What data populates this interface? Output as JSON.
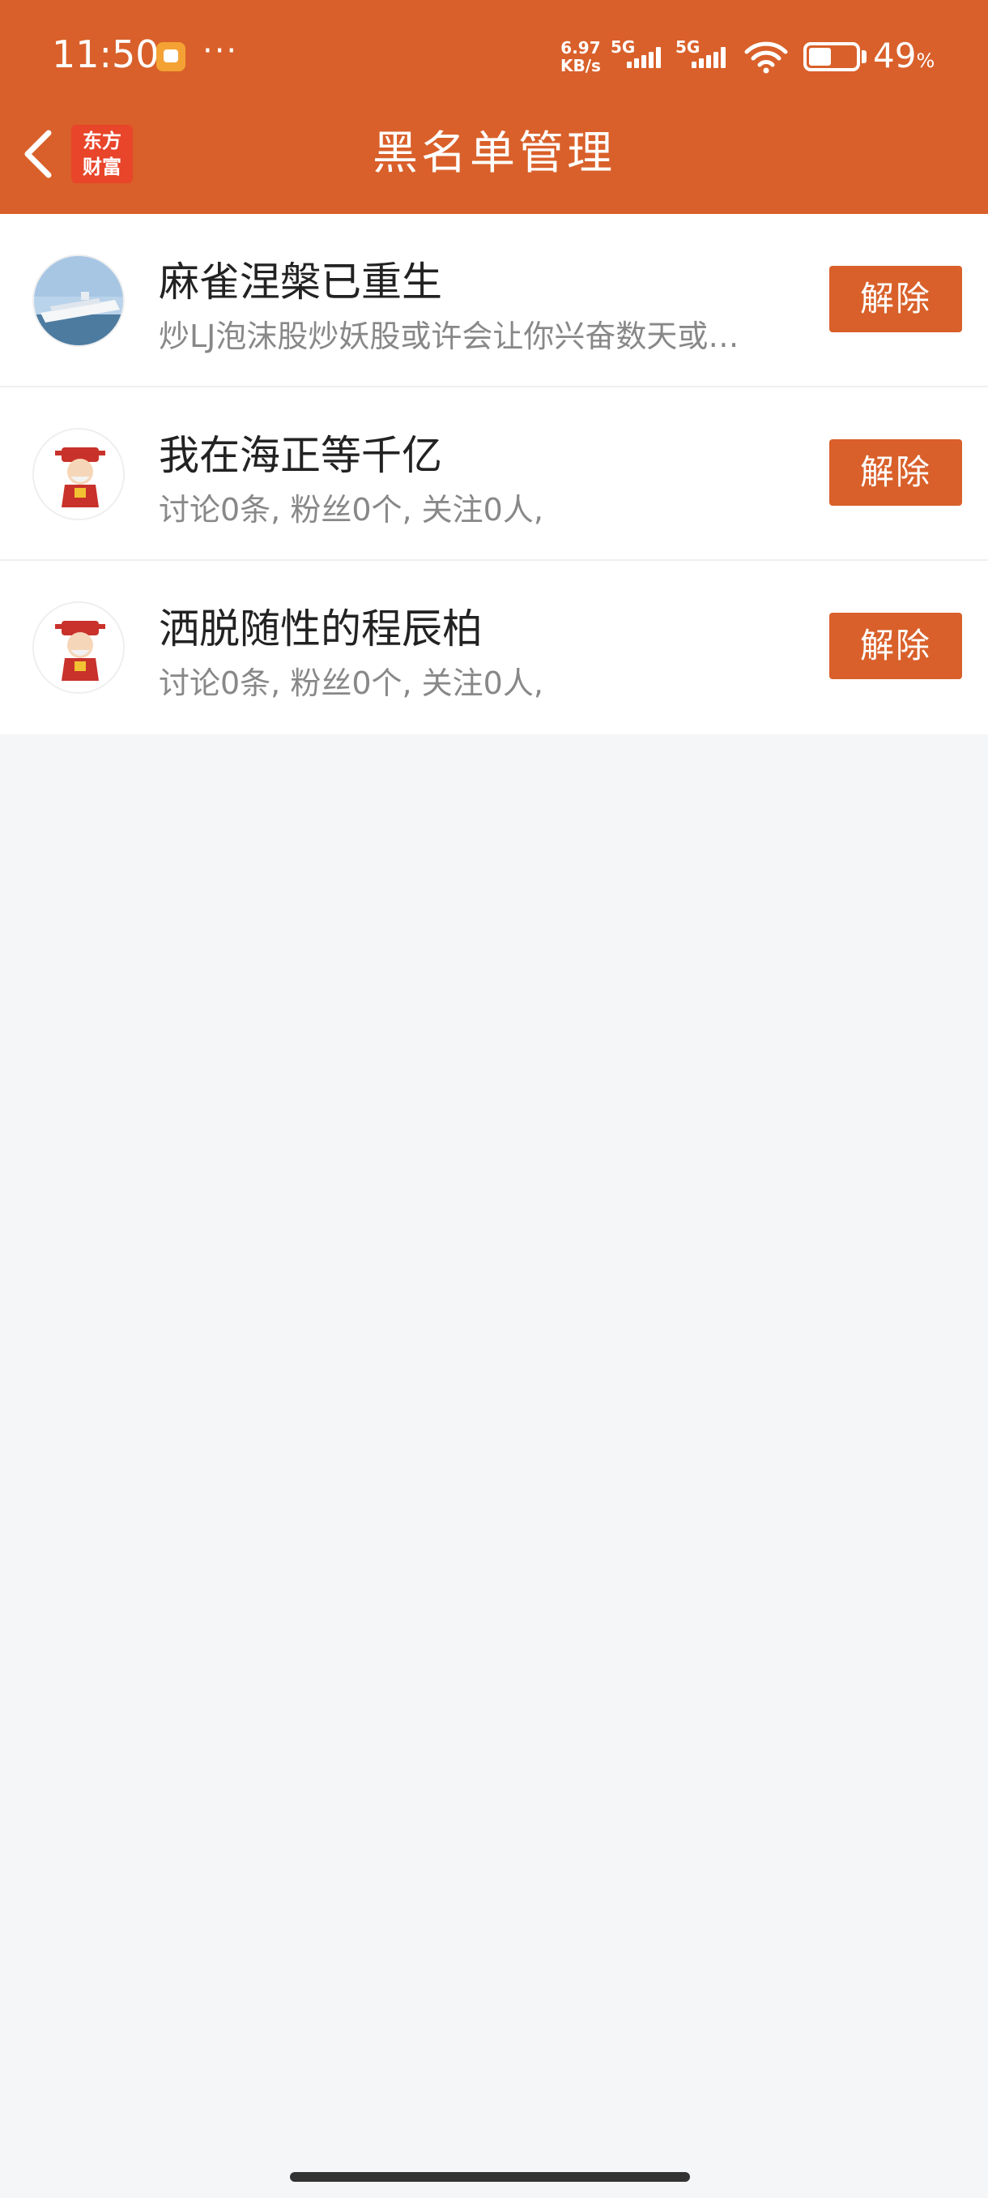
{
  "status_bar": {
    "time": "11:50",
    "net_speed_value": "6.97",
    "net_speed_unit": "KB/s",
    "sim1_label": "5G",
    "sim2_label": "5G",
    "battery_percent": "49",
    "battery_level": 0.49,
    "icons": [
      "notification-app-icon",
      "more-notifications-icon",
      "signal-icon",
      "wifi-icon",
      "battery-icon"
    ]
  },
  "header": {
    "title": "黑名单管理",
    "logo_line1": "东方",
    "logo_line2": "财富",
    "accent_color": "#d9602a"
  },
  "blacklist": [
    {
      "name": "麻雀涅槃已重生",
      "description": "炒LJ泡沫股炒妖股或许会让你兴奋数天或…",
      "avatar": "ship-photo",
      "action_label": "解除"
    },
    {
      "name": "我在海正等千亿",
      "description": "讨论0条, 粉丝0个, 关注0人,",
      "avatar": "caishen-cartoon",
      "action_label": "解除"
    },
    {
      "name": "洒脱随性的程辰柏",
      "description": "讨论0条, 粉丝0个, 关注0人,",
      "avatar": "caishen-cartoon",
      "action_label": "解除"
    }
  ]
}
